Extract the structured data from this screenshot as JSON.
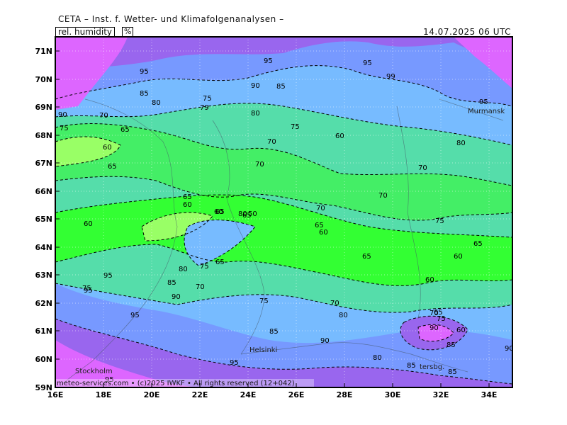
{
  "header": {
    "title": "CETA – Inst. f. Wetter- und Klimafolgenanalysen –",
    "variable": "rel. humidity",
    "unit": "%",
    "valid_time": "14.07.2025 06 UTC"
  },
  "axes": {
    "lat_labels": [
      "71N",
      "70N",
      "69N",
      "68N",
      "67N",
      "66N",
      "65N",
      "64N",
      "63N",
      "62N",
      "61N",
      "60N",
      "59N"
    ],
    "lon_labels": [
      "16E",
      "18E",
      "20E",
      "22E",
      "24E",
      "26E",
      "28E",
      "30E",
      "32E",
      "34E"
    ]
  },
  "cities": [
    "Murmansk",
    "Helsinki",
    "Stockholm",
    "tersbg."
  ],
  "contour_labels": [
    "95",
    "95",
    "95",
    "99",
    "95",
    "90",
    "85",
    "85",
    "80",
    "75",
    "79",
    "90",
    "70",
    "65",
    "80",
    "75",
    "75",
    "60",
    "70",
    "80",
    "60",
    "65",
    "70",
    "70",
    "70",
    "65",
    "60",
    "60",
    "65",
    "60",
    "75",
    "80",
    "65",
    "70",
    "60",
    "65",
    "60",
    "60",
    "65",
    "80",
    "75",
    "65",
    "85",
    "90",
    "70",
    "75",
    "70",
    "80",
    "75",
    "90",
    "60",
    "65",
    "85",
    "95",
    "70",
    "75",
    "90",
    "80",
    "85",
    "95",
    "90",
    "95",
    "85",
    "85",
    "95",
    "95",
    "65",
    "50"
  ],
  "footer": {
    "copyright": "meteo-services.com • (c)2025 IWKF • All rights reserved (12+042)"
  },
  "colors": {
    "very_dry": "#33ff33",
    "dry": "#44ee66",
    "mid": "#55ddaa",
    "moist": "#77bbff",
    "wet": "#7799ff",
    "very_wet": "#9966ee",
    "saturated": "#dd66ff"
  }
}
